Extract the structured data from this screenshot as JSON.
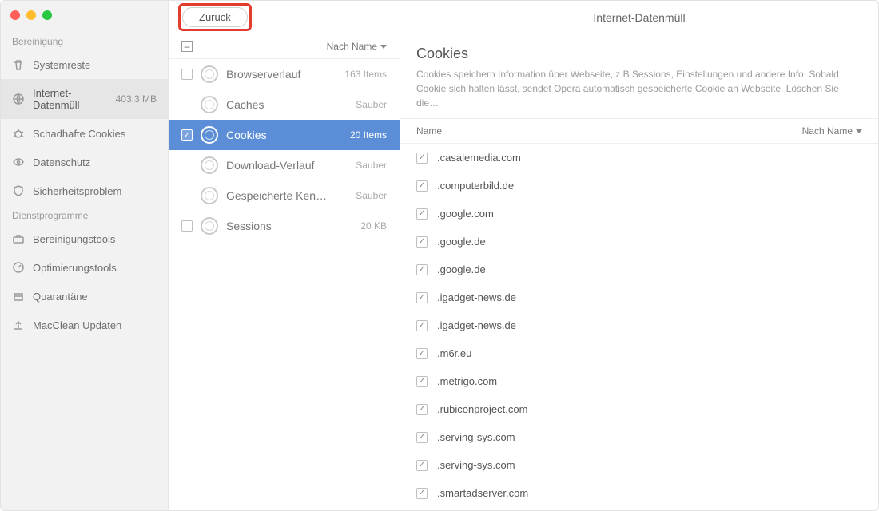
{
  "window": {
    "title": "Internet-Datenmüll"
  },
  "back_button": "Zurück",
  "sidebar": {
    "sections": [
      {
        "title": "Bereinigung",
        "items": [
          {
            "id": "systemreste",
            "label": "Systemreste",
            "icon": "trash-icon",
            "meta": "",
            "active": false
          },
          {
            "id": "internet",
            "label": "Internet-Datenmüll",
            "icon": "globe-icon",
            "meta": "403.3 MB",
            "active": true
          },
          {
            "id": "cookies",
            "label": "Schadhafte Cookies",
            "icon": "bug-icon",
            "meta": "",
            "active": false
          },
          {
            "id": "datenschutz",
            "label": "Datenschutz",
            "icon": "eye-icon",
            "meta": "",
            "active": false
          },
          {
            "id": "sicherheit",
            "label": "Sicherheitsproblem",
            "icon": "shield-icon",
            "meta": "",
            "active": false
          }
        ]
      },
      {
        "title": "Dienstprogramme",
        "items": [
          {
            "id": "tools",
            "label": "Bereinigungstools",
            "icon": "toolbox-icon",
            "meta": "",
            "active": false
          },
          {
            "id": "optimize",
            "label": "Optimierungstools",
            "icon": "gauge-icon",
            "meta": "",
            "active": false
          },
          {
            "id": "quarantine",
            "label": "Quarantäne",
            "icon": "box-icon",
            "meta": "",
            "active": false
          },
          {
            "id": "update",
            "label": "MacClean Updaten",
            "icon": "upload-icon",
            "meta": "",
            "active": false
          }
        ]
      }
    ]
  },
  "middle": {
    "sort_label": "Nach Name",
    "collapse_glyph": "–",
    "categories": [
      {
        "label": "Browserverlauf",
        "meta": "163 Items",
        "checked": false,
        "child": false,
        "selected": false,
        "show_chk": true
      },
      {
        "label": "Caches",
        "meta": "Sauber",
        "checked": false,
        "child": true,
        "selected": false,
        "show_chk": false
      },
      {
        "label": "Cookies",
        "meta": "20 Items",
        "checked": true,
        "child": false,
        "selected": true,
        "show_chk": true
      },
      {
        "label": "Download-Verlauf",
        "meta": "Sauber",
        "checked": false,
        "child": true,
        "selected": false,
        "show_chk": false
      },
      {
        "label": "Gespeicherte Ken…",
        "meta": "Sauber",
        "checked": false,
        "child": true,
        "selected": false,
        "show_chk": false
      },
      {
        "label": "Sessions",
        "meta": "20 KB",
        "checked": false,
        "child": false,
        "selected": false,
        "show_chk": true
      }
    ]
  },
  "detail": {
    "heading": "Cookies",
    "description": "Cookies speichern Information über Webseite, z.B Sessions, Einstellungen und andere Info. Sobald Cookie sich halten lässt, sendet Opera automatisch gespeicherte Cookie an Webseite. Löschen Sie die…",
    "col_name": "Name",
    "col_sort": "Nach Name",
    "items": [
      ".casalemedia.com",
      ".computerbild.de",
      ".google.com",
      ".google.de",
      ".google.de",
      ".igadget-news.de",
      ".igadget-news.de",
      ".m6r.eu",
      ".metrigo.com",
      ".rubiconproject.com",
      ".serving-sys.com",
      ".serving-sys.com",
      ".smartadserver.com"
    ]
  }
}
